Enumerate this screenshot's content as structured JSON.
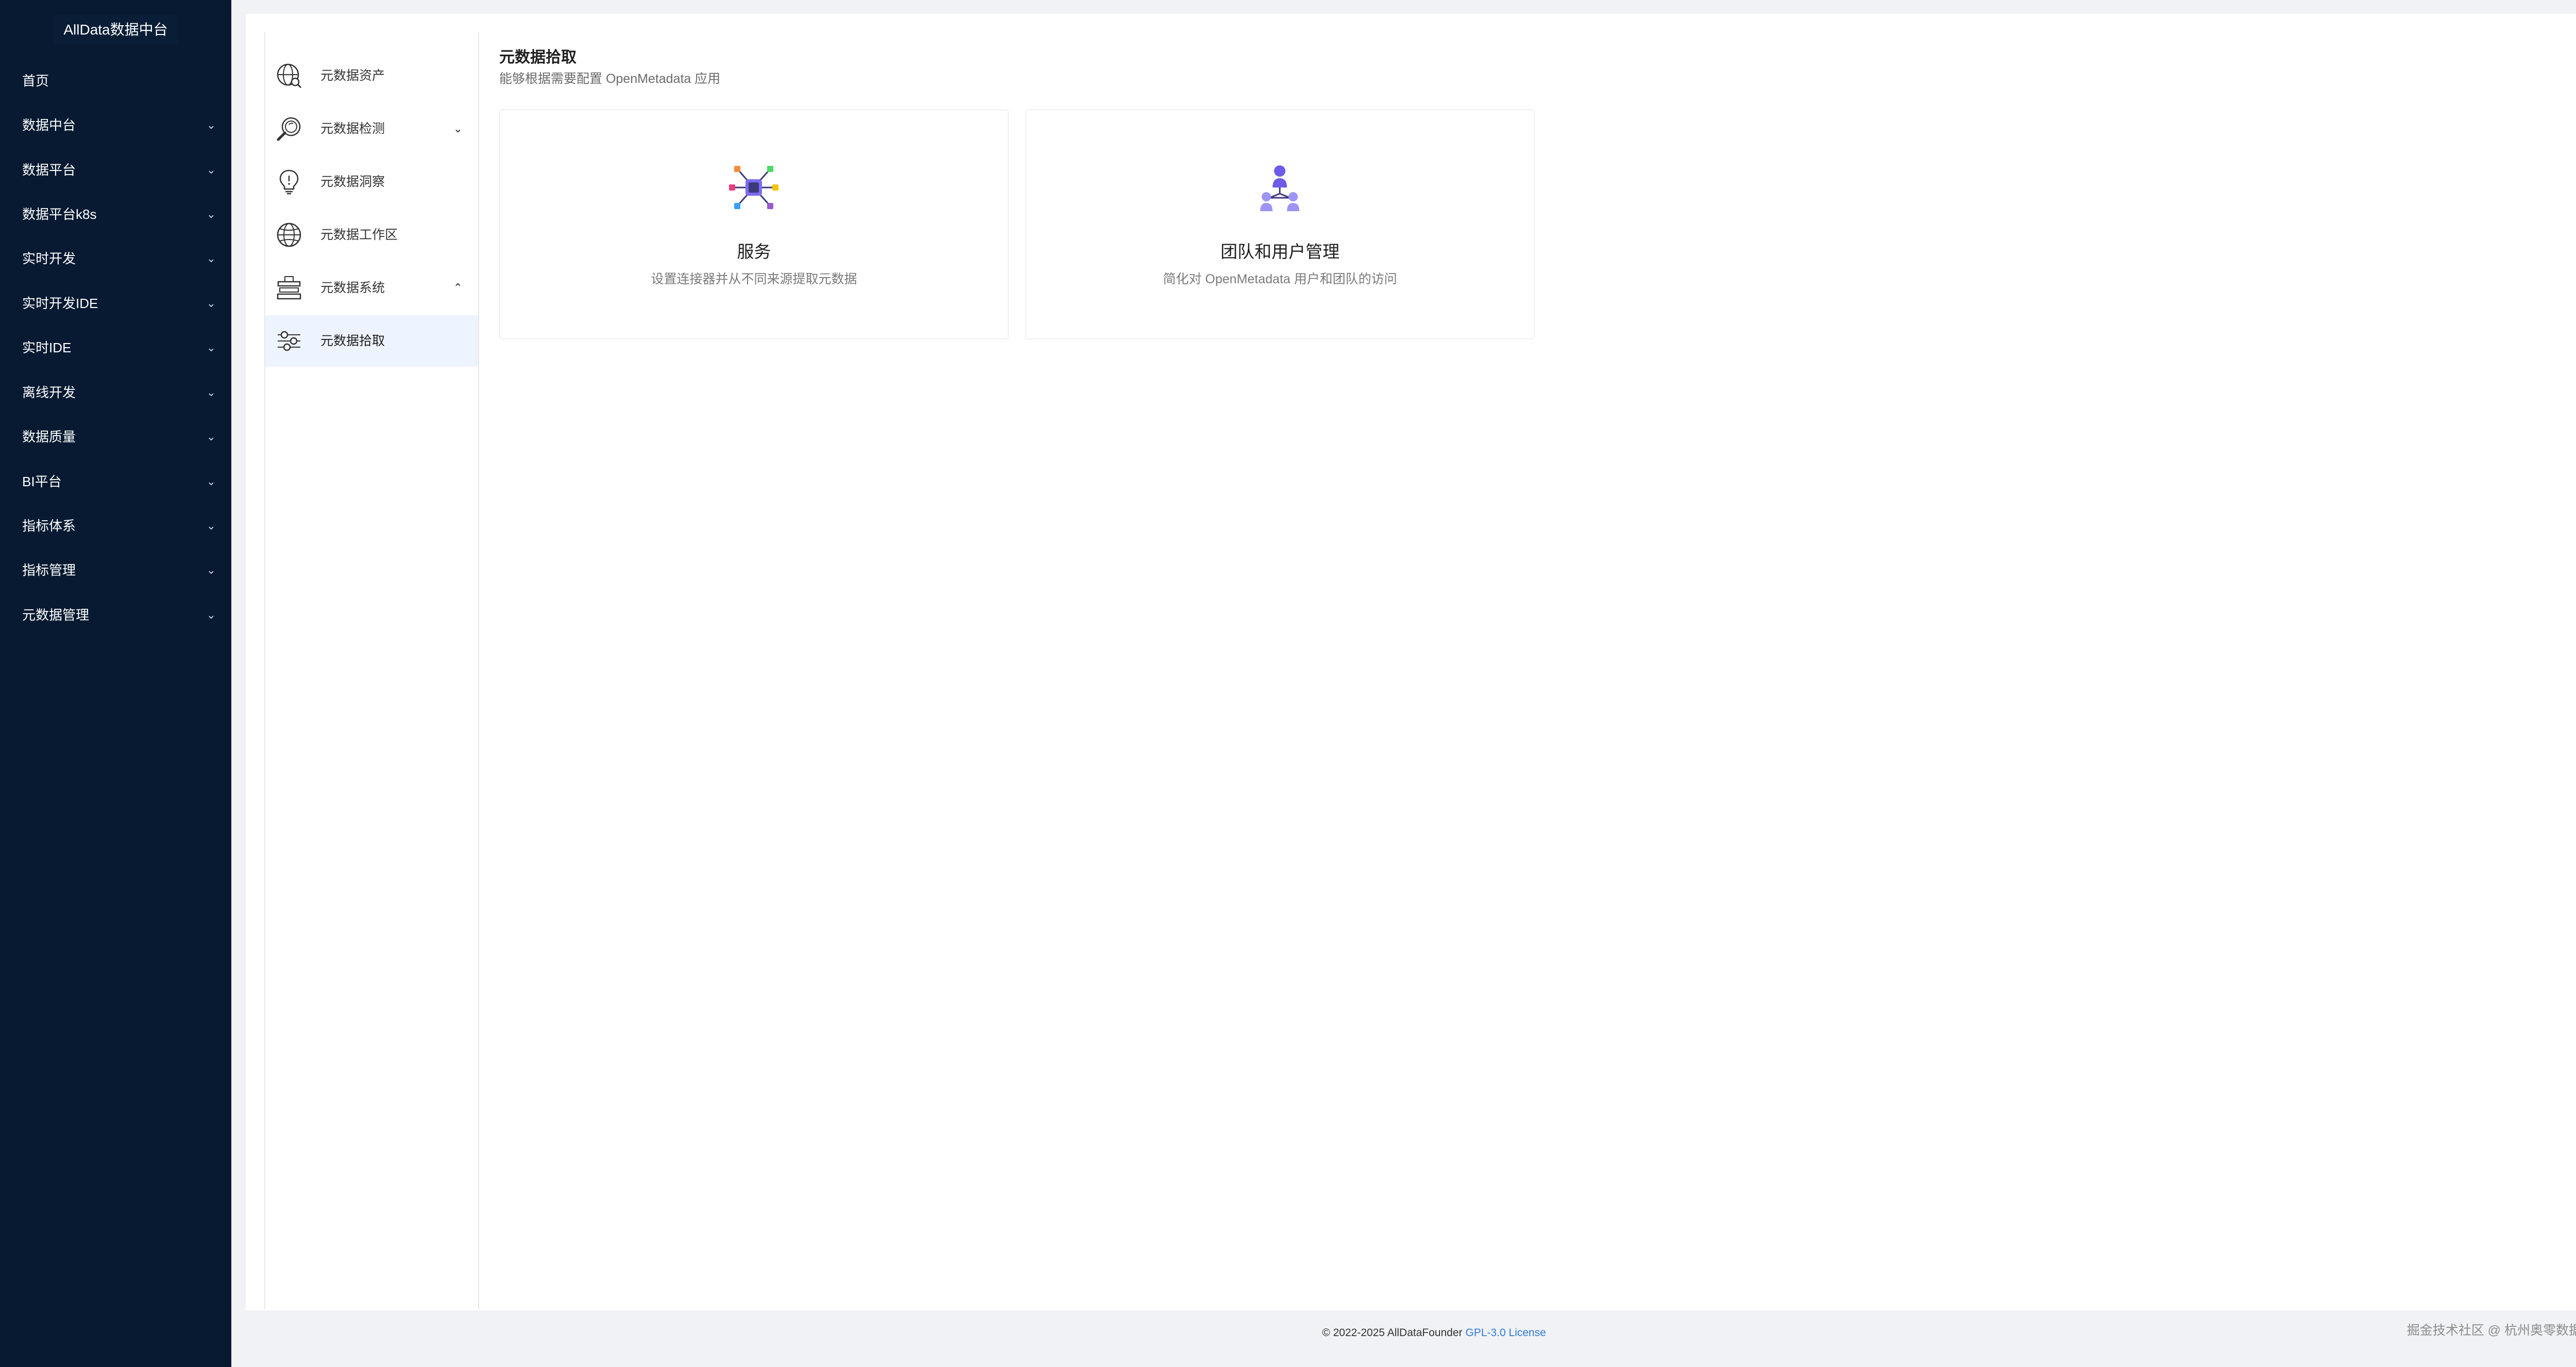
{
  "app": {
    "brand": "AllData数据中台"
  },
  "sidebar": {
    "items": [
      {
        "label": "首页",
        "has_children": false
      },
      {
        "label": "数据中台",
        "has_children": true
      },
      {
        "label": "数据平台",
        "has_children": true
      },
      {
        "label": "数据平台k8s",
        "has_children": true
      },
      {
        "label": "实时开发",
        "has_children": true
      },
      {
        "label": "实时开发IDE",
        "has_children": true
      },
      {
        "label": "实时IDE",
        "has_children": true
      },
      {
        "label": "离线开发",
        "has_children": true
      },
      {
        "label": "数据质量",
        "has_children": true
      },
      {
        "label": "BI平台",
        "has_children": true
      },
      {
        "label": "指标体系",
        "has_children": true
      },
      {
        "label": "指标管理",
        "has_children": true
      },
      {
        "label": "元数据管理",
        "has_children": true
      }
    ],
    "chevron": "⌄"
  },
  "subnav": {
    "items": [
      {
        "label": "元数据资产",
        "icon": "globe-search-icon"
      },
      {
        "label": "元数据检测",
        "icon": "magnifier-icon",
        "caret": "⌄"
      },
      {
        "label": "元数据洞察",
        "icon": "lightbulb-icon"
      },
      {
        "label": "元数据工作区",
        "icon": "globe-icon"
      },
      {
        "label": "元数据系统",
        "icon": "building-icon",
        "caret": "⌃"
      },
      {
        "label": "元数据拾取",
        "icon": "sliders-icon",
        "active": true
      }
    ]
  },
  "main": {
    "title": "元数据拾取",
    "subtitle": "能够根据需要配置 OpenMetadata 应用",
    "cards": [
      {
        "title": "服务",
        "desc": "设置连接器并从不同来源提取元数据",
        "icon": "connector-hub-icon"
      },
      {
        "title": "团队和用户管理",
        "desc": "简化对 OpenMetadata 用户和团队的访问",
        "icon": "team-users-icon"
      }
    ]
  },
  "footer": {
    "copyright": "© 2022-2025 AllDataFounder",
    "license": "GPL-3.0 License",
    "watermark": "掘金技术社区 @ 杭州奥零数据科技"
  },
  "colors": {
    "sidebar_bg": "#071a31",
    "active_bg": "#eef4ff",
    "link": "#2f7bd9",
    "accent_purple": "#7b6cf0"
  }
}
